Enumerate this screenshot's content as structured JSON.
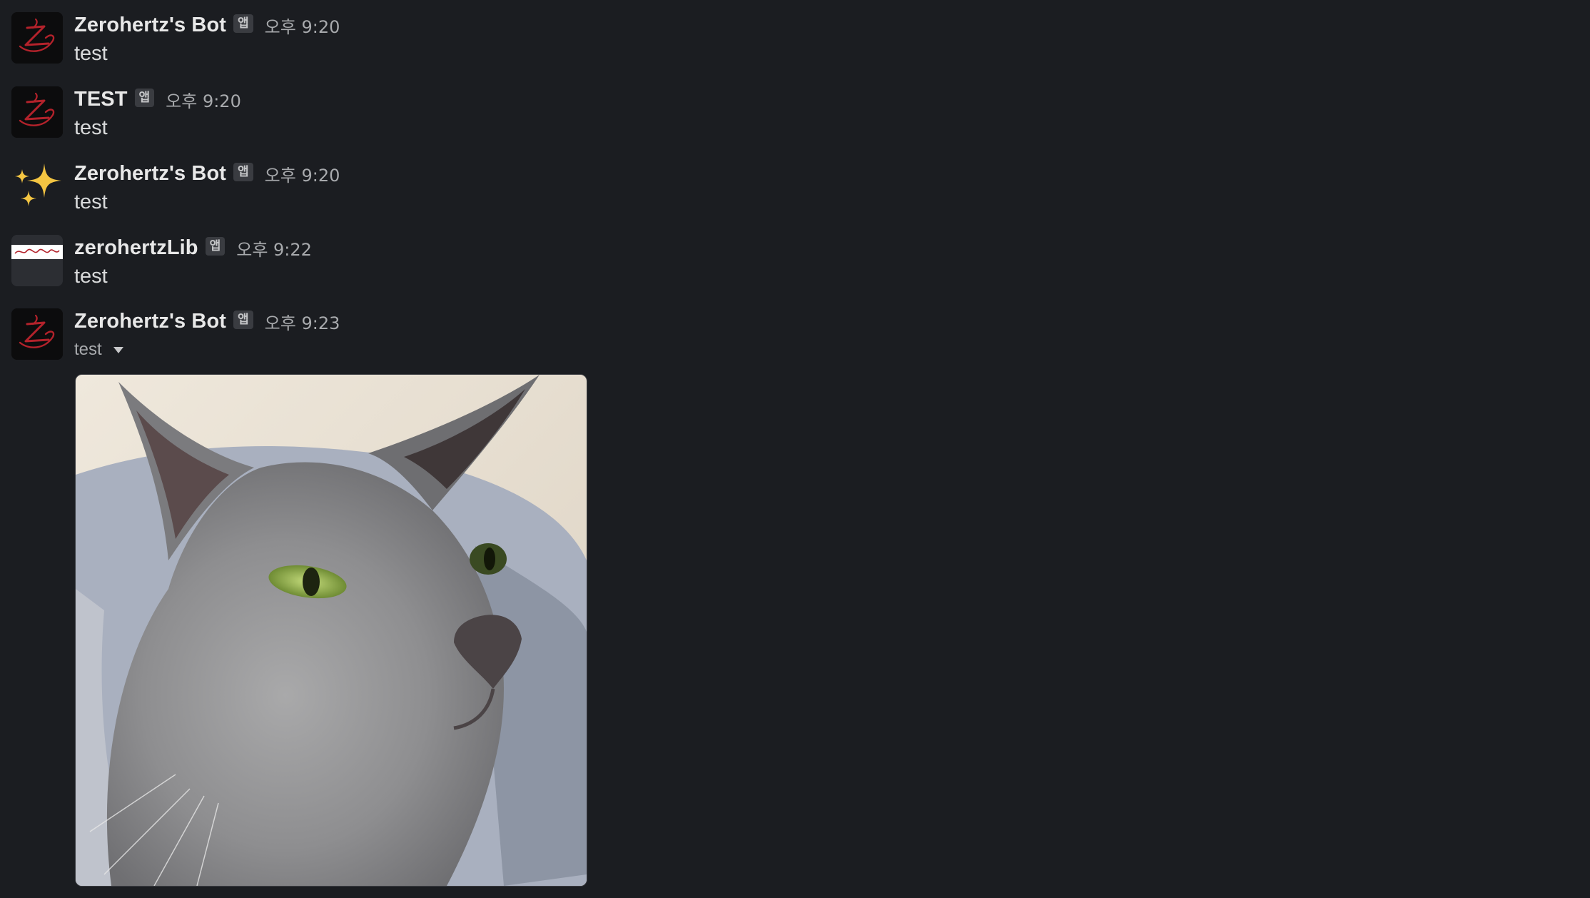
{
  "messages": [
    {
      "sender": "Zerohertz's Bot",
      "badge": "앱",
      "time": "오후 9:20",
      "text": "test",
      "avatar_icon": "zerohertz-logo-icon"
    },
    {
      "sender": "TEST",
      "badge": "앱",
      "time": "오후 9:20",
      "text": "test",
      "avatar_icon": "zerohertz-logo-icon"
    },
    {
      "sender": "Zerohertz's Bot",
      "badge": "앱",
      "time": "오후 9:20",
      "text": "test",
      "avatar_icon": "sparkles-icon"
    },
    {
      "sender": "zerohertzLib",
      "badge": "앱",
      "time": "오후 9:22",
      "text": "test",
      "avatar_icon": "zerohertzlib-logo-icon"
    },
    {
      "sender": "Zerohertz's Bot",
      "badge": "앱",
      "time": "오후 9:23",
      "file_label": "test",
      "avatar_icon": "zerohertz-logo-icon",
      "attachment": "gray-cat-photo"
    }
  ],
  "colors": {
    "background": "#1b1d21",
    "name": "#e8e8e8",
    "timestamp": "#a8aaad",
    "badge_bg": "#3a3c41",
    "logo_red": "#b3222b",
    "sparkle": "#f4c542"
  }
}
